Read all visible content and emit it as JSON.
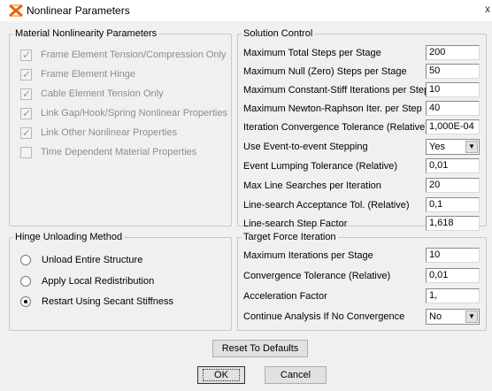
{
  "window": {
    "title": "Nonlinear Parameters",
    "close_glyph": "x"
  },
  "material_nonlinearity": {
    "legend": "Material Nonlinearity Parameters",
    "items": [
      {
        "label": "Frame Element Tension/Compression Only",
        "checked": true,
        "enabled": false
      },
      {
        "label": "Frame Element Hinge",
        "checked": true,
        "enabled": false
      },
      {
        "label": "Cable Element Tension Only",
        "checked": true,
        "enabled": false
      },
      {
        "label": "Link Gap/Hook/Spring Nonlinear Properties",
        "checked": true,
        "enabled": false
      },
      {
        "label": "Link Other Nonlinear Properties",
        "checked": true,
        "enabled": false
      },
      {
        "label": "Time Dependent Material Properties",
        "checked": false,
        "enabled": false
      }
    ]
  },
  "solution_control": {
    "legend": "Solution Control",
    "params": [
      {
        "label": "Maximum Total Steps per Stage",
        "value": "200",
        "kind": "input"
      },
      {
        "label": "Maximum Null (Zero) Steps per Stage",
        "value": "50",
        "kind": "input"
      },
      {
        "label": "Maximum Constant-Stiff Iterations per Step",
        "value": "10",
        "kind": "input"
      },
      {
        "label": "Maximum Newton-Raphson Iter. per Step",
        "value": "40",
        "kind": "input"
      },
      {
        "label": "Iteration Convergence Tolerance (Relative)",
        "value": "1,000E-04",
        "kind": "input"
      },
      {
        "label": "Use Event-to-event Stepping",
        "value": "Yes",
        "kind": "select"
      },
      {
        "label": "Event Lumping Tolerance (Relative)",
        "value": "0,01",
        "kind": "input"
      },
      {
        "label": "Max Line Searches per Iteration",
        "value": "20",
        "kind": "input"
      },
      {
        "label": "Line-search Acceptance Tol. (Relative)",
        "value": "0,1",
        "kind": "input"
      },
      {
        "label": "Line-search Step Factor",
        "value": "1,618",
        "kind": "input"
      }
    ]
  },
  "hinge_unloading": {
    "legend": "Hinge Unloading Method",
    "options": [
      {
        "label": "Unload Entire Structure",
        "selected": false
      },
      {
        "label": "Apply Local Redistribution",
        "selected": false
      },
      {
        "label": "Restart Using Secant Stiffness",
        "selected": true
      }
    ]
  },
  "target_force": {
    "legend": "Target Force Iteration",
    "params": [
      {
        "label": "Maximum Iterations per Stage",
        "value": "10",
        "kind": "input"
      },
      {
        "label": "Convergence Tolerance (Relative)",
        "value": "0,01",
        "kind": "input"
      },
      {
        "label": "Acceleration Factor",
        "value": "1,",
        "kind": "input"
      },
      {
        "label": "Continue Analysis If No Convergence",
        "value": "No",
        "kind": "select"
      }
    ]
  },
  "buttons": {
    "reset": "Reset To Defaults",
    "ok": "OK",
    "cancel": "Cancel"
  },
  "icons": {
    "app": "sap-app-icon",
    "dropdown": "chevron-down-icon",
    "check": "checkmark-icon"
  },
  "colors": {
    "dialog_bg": "#f0f0f0",
    "disabled_text": "#8d8d8d",
    "group_border": "#c9c9c9"
  }
}
